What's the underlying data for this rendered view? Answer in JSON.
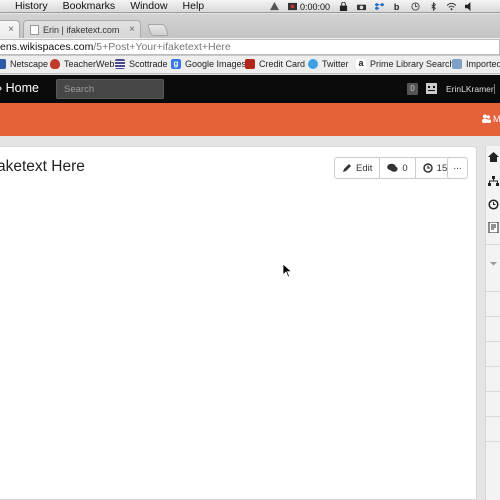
{
  "os_menu": {
    "items": [
      "History",
      "Bookmarks",
      "Window",
      "Help"
    ],
    "clock": "0:00:00"
  },
  "tabs": [
    {
      "label": "",
      "active": true
    },
    {
      "label": "Erin | ifaketext.com",
      "active": false
    }
  ],
  "address": {
    "host": "ens.wikispaces.com",
    "path": "/5+Post+Your+ifaketext+Here"
  },
  "bookmarks": [
    {
      "label": "Netscape",
      "icon": "netscape-icon",
      "color": "#2b5aa6"
    },
    {
      "label": "TeacherWeb",
      "icon": "apple-icon",
      "color": "#c0392b"
    },
    {
      "label": "Scottrade",
      "icon": "scottrade-icon",
      "color": "#4a4a8a"
    },
    {
      "label": "Google Images",
      "icon": "google-icon",
      "color": "#3b78e7"
    },
    {
      "label": "Credit Card",
      "icon": "card-icon",
      "color": "#b3261e"
    },
    {
      "label": "Twitter",
      "icon": "twitter-icon",
      "color": "#3ea0e6"
    },
    {
      "label": "Prime Library Search",
      "icon": "amazon-icon",
      "color": "#222222"
    },
    {
      "label": "Imported F",
      "icon": "folder-icon",
      "color": "#7ea1c8"
    }
  ],
  "site_nav": {
    "home_label": "Home",
    "search_placeholder": "Search",
    "notification_count": "0",
    "username": "ErinLKramer"
  },
  "banner": {
    "members_label": "M",
    "color": "#e5613a"
  },
  "page": {
    "title": "aketext Here",
    "edit_label": "Edit",
    "comments_count": "0",
    "history_count": "15",
    "more_label": "..."
  }
}
